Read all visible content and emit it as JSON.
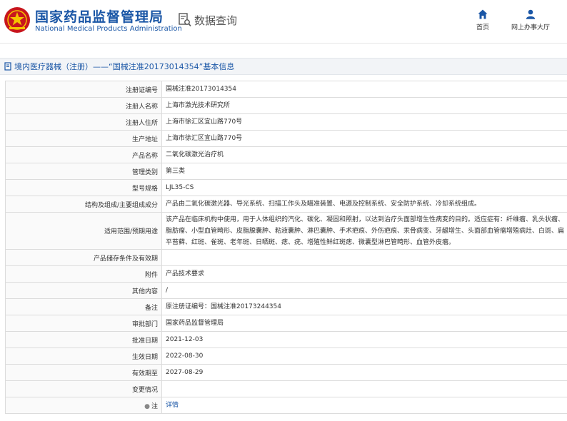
{
  "header": {
    "brand_cn": "国家药品监督管理局",
    "brand_en": "National Medical Products Administration",
    "search_label": "数据查询",
    "nav_home": "首页",
    "nav_hall": "网上办事大厅",
    "brand_color": "#1a56a6",
    "logo_color": "#c8161d"
  },
  "breadcrumb": {
    "text": "境内医疗器械（注册）——“国械注准20173014354”基本信息"
  },
  "detail": {
    "rows": [
      {
        "label": "注册证编号",
        "value": "国械注准20173014354"
      },
      {
        "label": "注册人名称",
        "value": "上海市激光技术研究所"
      },
      {
        "label": "注册人住所",
        "value": "上海市徐汇区宜山路770号"
      },
      {
        "label": "生产地址",
        "value": "上海市徐汇区宜山路770号"
      },
      {
        "label": "产品名称",
        "value": "二氧化碳激光治疗机"
      },
      {
        "label": "管理类别",
        "value": "第三类"
      },
      {
        "label": "型号规格",
        "value": "LJL35-CS"
      },
      {
        "label": "结构及组成/主要组成成分",
        "value": "产品由二氧化碳激光器、导光系统、扫描工作头及瞄准装置、电源及控制系统、安全防护系统、冷却系统组成。"
      },
      {
        "label": "适用范围/预期用途",
        "value": "该产品在临床机构中使用，用于人体组织的汽化、碳化、凝固和照射，以达到治疗头面部增生性病变的目的。适应症有：纤维瘤、乳头状瘤、脂肪瘤、小型血管畸形、皮脂腺囊肿、粘液囊肿、淋巴囊肿、手术疤痕、外伤疤痕、汞骨病变、牙龈增生、头面部血管瘤增殖病灶、白斑、扁平苔藓、红斑、雀斑、老年斑、日晒斑、痣、疣、增殖性鲜红斑痣、微囊型淋巴管畸形、血管外皮瘤。"
      },
      {
        "label": "产品储存条件及有效期",
        "value": ""
      },
      {
        "label": "附件",
        "value": "产品技术要求"
      },
      {
        "label": "其他内容",
        "value": "/"
      },
      {
        "label": "备注",
        "value": "原注册证编号：国械注准20173244354"
      },
      {
        "label": "审批部门",
        "value": "国家药品监督管理局"
      },
      {
        "label": "批准日期",
        "value": "2021-12-03"
      },
      {
        "label": "生效日期",
        "value": "2022-08-30"
      },
      {
        "label": "有效期至",
        "value": "2027-08-29"
      },
      {
        "label": "变更情况",
        "value": ""
      }
    ],
    "note_label": "注",
    "note_link": "详情"
  }
}
